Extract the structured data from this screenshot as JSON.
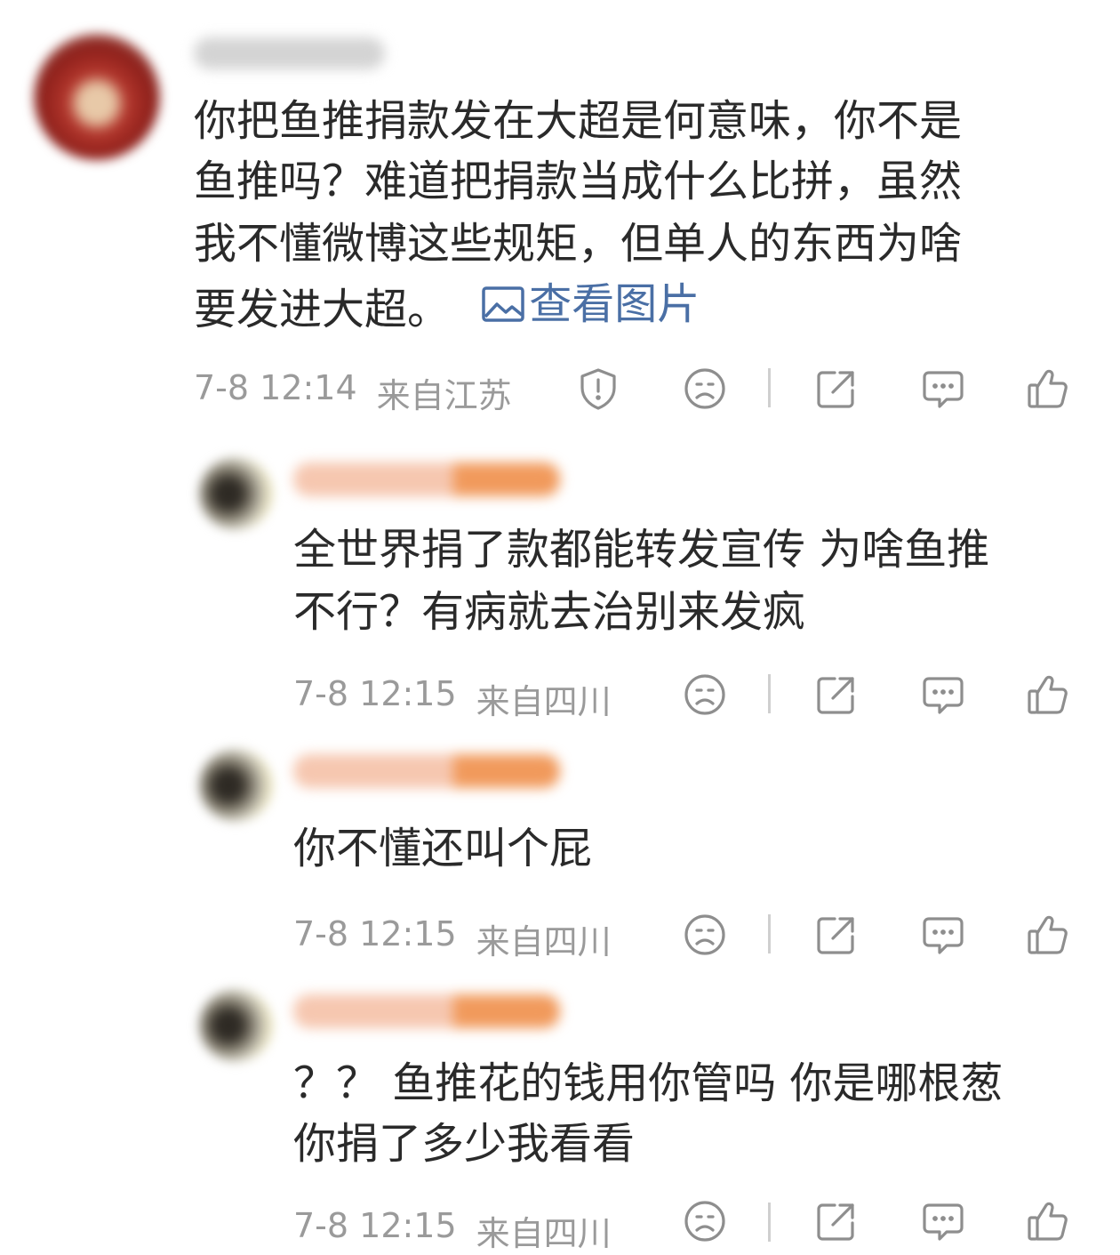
{
  "comments": [
    {
      "lines": [
        "你把鱼推捐款发在大超是何意味，你不是",
        "鱼推吗？难道把捐款当成什么比拼，虽然",
        "我不懂微博这些规矩，但单人的东西为啥",
        "要发进大超。"
      ],
      "view_image_label": "查看图片",
      "time": "7-8 12:14",
      "location": "来自江苏"
    },
    {
      "lines": [
        "全世界捐了款都能转发宣传 为啥鱼推",
        "不行？有病就去治别来发疯"
      ],
      "time": "7-8 12:15",
      "location": "来自四川"
    },
    {
      "lines": [
        "你不懂还叫个屁"
      ],
      "time": "7-8 12:15",
      "location": "来自四川"
    },
    {
      "lines": [
        "？？ 鱼推花的钱用你管吗 你是哪根葱",
        "你捐了多少我看看"
      ],
      "time": "7-8 12:15",
      "location": "来自四川"
    }
  ],
  "icons": {
    "report": "shield-alert-icon",
    "dislike": "sad-face-icon",
    "share": "share-icon",
    "reply": "comment-bubble-icon",
    "like": "thumbs-up-icon"
  },
  "colors": {
    "text": "#2a2a2a",
    "meta": "#9a9a9a",
    "link": "#4a6fa5",
    "icon": "#8e8e8e"
  }
}
